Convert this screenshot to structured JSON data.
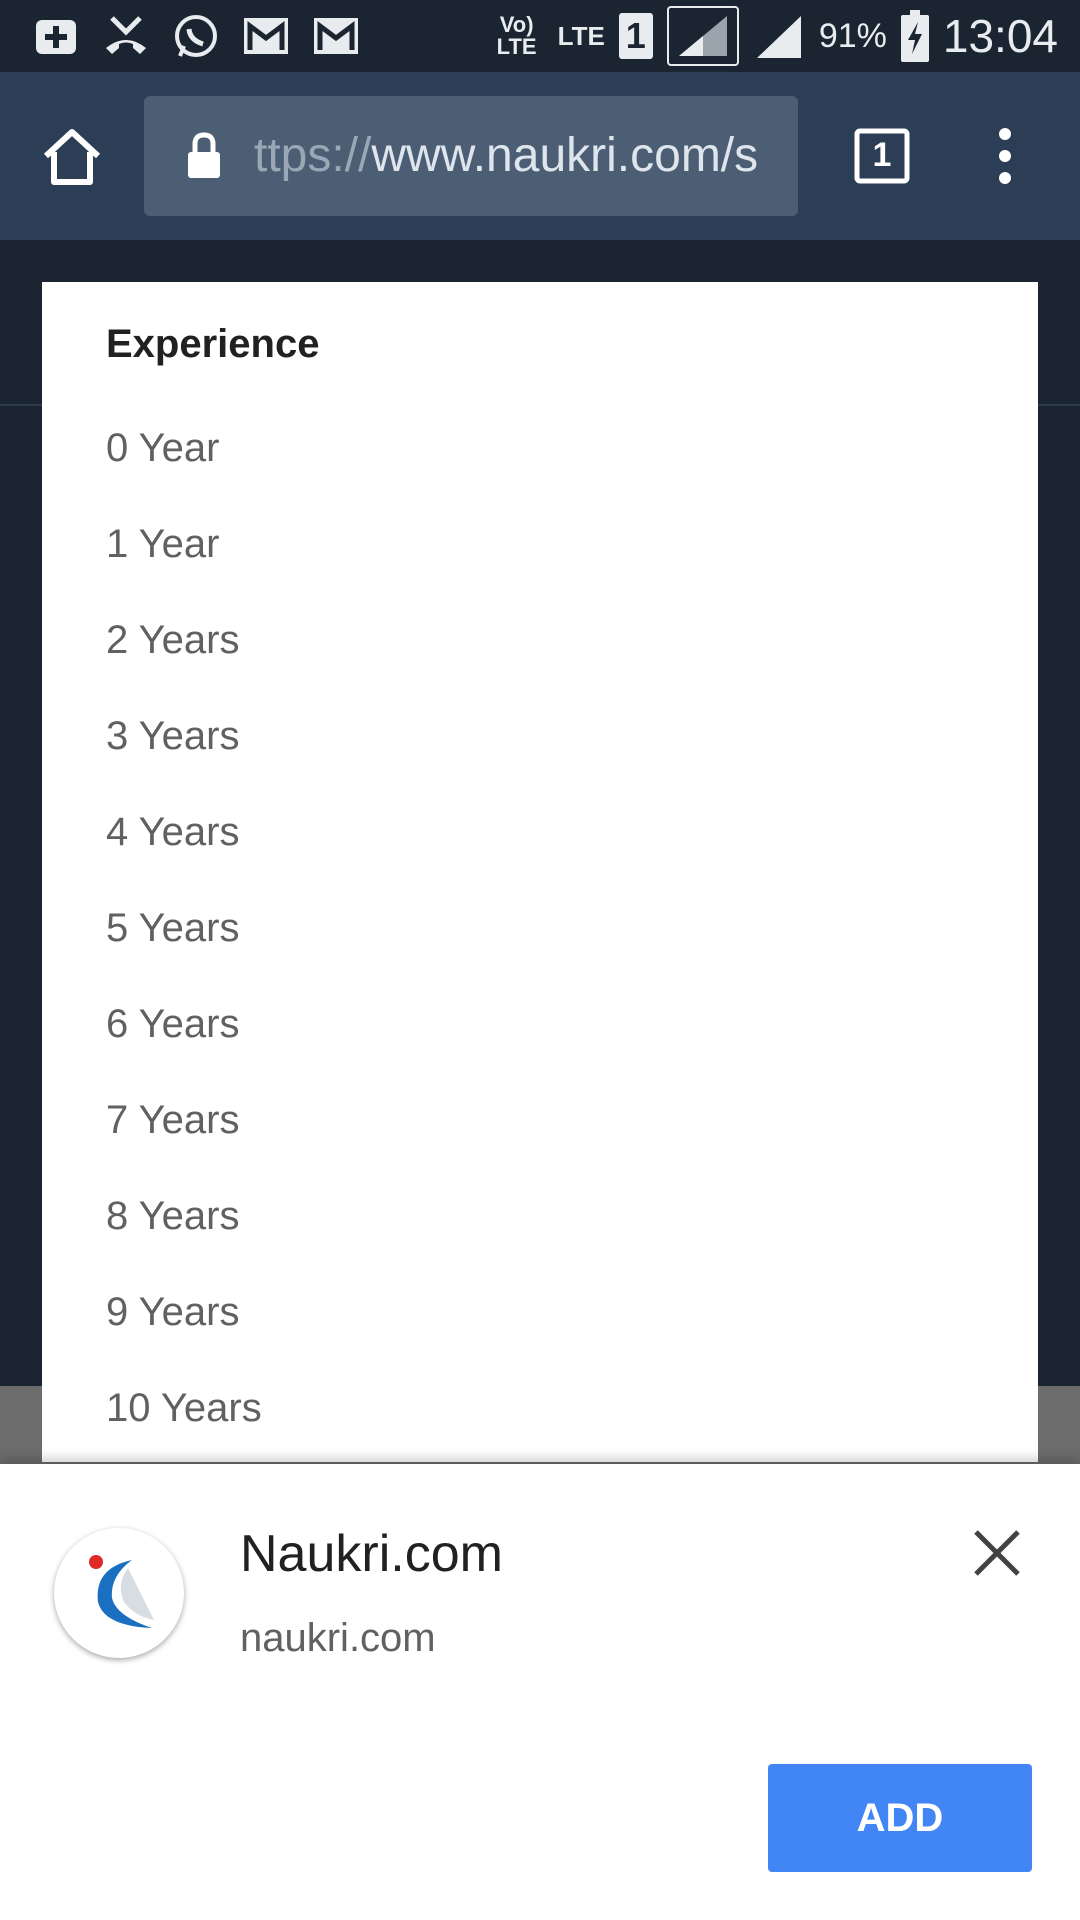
{
  "status_bar": {
    "network_label": "Vo) LTE",
    "lte_label": "LTE",
    "sim_label": "1",
    "battery_percent": "91%",
    "time": "13:04"
  },
  "browser": {
    "url_prefix": "ttps://",
    "url_host": "www.naukri.com/s",
    "tab_count": "1"
  },
  "dialog": {
    "title": "Experience",
    "options": [
      "0 Year",
      "1 Year",
      "2 Years",
      "3 Years",
      "4 Years",
      "5 Years",
      "6 Years",
      "7 Years",
      "8 Years",
      "9 Years",
      "10 Years"
    ]
  },
  "install_sheet": {
    "app_name": "Naukri.com",
    "app_url": "naukri.com",
    "add_label": "ADD"
  },
  "colors": {
    "toolbar": "#2c3e55",
    "accent_button": "#4285f4",
    "logo_blue": "#1a6fc0",
    "logo_red": "#e02a2a"
  }
}
